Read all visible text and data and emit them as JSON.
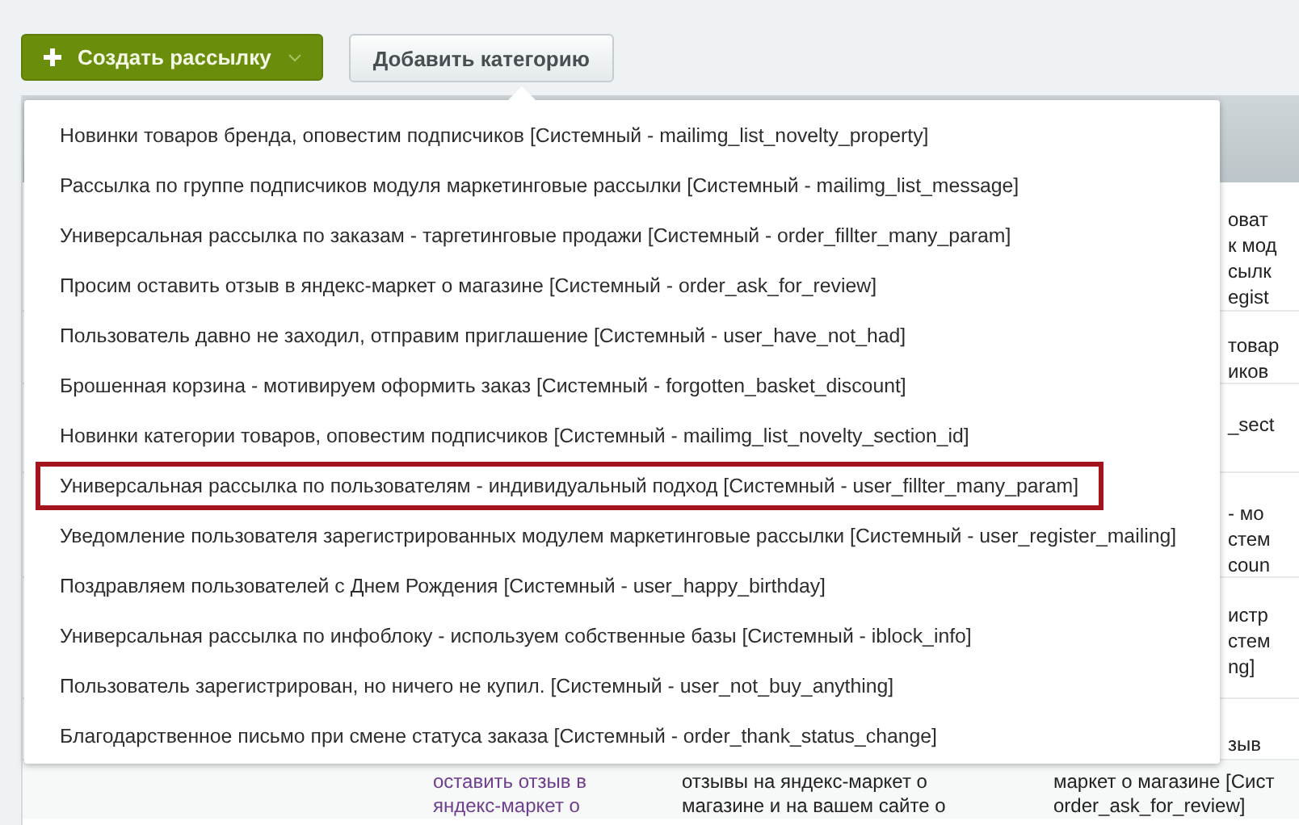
{
  "toolbar": {
    "create_button": {
      "label": "Создать рассылку"
    },
    "add_button": {
      "label": "Добавить категорию"
    }
  },
  "dropdown_menu": {
    "items": [
      {
        "label": "Новинки товаров бренда, оповестим подписчиков [Системный - mailimg_list_novelty_property]",
        "highlighted": false
      },
      {
        "label": "Рассылка по группе подписчиков модуля маркетинговые рассылки [Системный - mailimg_list_message]",
        "highlighted": false
      },
      {
        "label": "Универсальная рассылка по заказам - таргетинговые продажи [Системный - order_fillter_many_param]",
        "highlighted": false
      },
      {
        "label": "Просим оставить отзыв в яндекс-маркет о магазине [Системный - order_ask_for_review]",
        "highlighted": false
      },
      {
        "label": "Пользователь давно не заходил, отправим приглашение [Системный - user_have_not_had]",
        "highlighted": false
      },
      {
        "label": "Брошенная корзина - мотивируем оформить заказ [Системный - forgotten_basket_discount]",
        "highlighted": false
      },
      {
        "label": "Новинки категории товаров, оповестим подписчиков [Системный - mailimg_list_novelty_section_id]",
        "highlighted": false
      },
      {
        "label": "Универсальная рассылка по пользователям - индивидуальный подход [Системный - user_fillter_many_param]",
        "highlighted": true
      },
      {
        "label": "Уведомление пользователя зарегистрированных модулем маркетинговые рассылки [Системный - user_register_mailing]",
        "highlighted": false
      },
      {
        "label": "Поздравляем пользователей с Днем Рождения [Системный - user_happy_birthday]",
        "highlighted": false
      },
      {
        "label": "Универсальная рассылка по инфоблоку - используем собственные базы [Системный - iblock_info]",
        "highlighted": false
      },
      {
        "label": "Пользователь зарегистрирован, но ничего не купил. [Системный - user_not_buy_anything]",
        "highlighted": false
      },
      {
        "label": "Благодарственное письмо при смене статуса заказа [Системный - order_thank_status_change]",
        "highlighted": false
      }
    ]
  },
  "background_table": {
    "right_fragments": [
      [
        "оват",
        "к мод",
        "сылк",
        "egist"
      ],
      [
        "товар",
        "иков"
      ],
      [
        "_sect"
      ],
      [
        "- мо",
        "стем",
        "coun"
      ],
      [
        "истр",
        "стем",
        "ng]"
      ],
      [
        "зыв"
      ]
    ],
    "last_row": {
      "column_2": [
        "оставить отзыв в",
        "яндекс-маркет о"
      ],
      "column_3": [
        "отзывы на яндекс-маркет о",
        "магазине и на вашем сайте о"
      ],
      "column_4": [
        "маркет о магазине [Сист",
        "order_ask_for_review]"
      ]
    }
  }
}
